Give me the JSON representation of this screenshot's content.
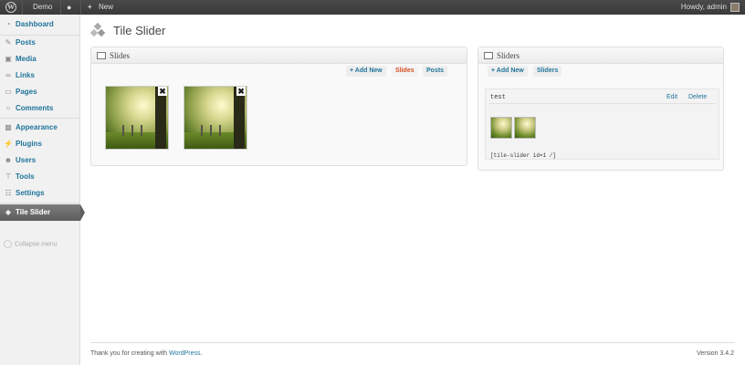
{
  "admin_bar": {
    "site_name": "Demo",
    "new_label": "New",
    "howdy": "Howdy, admin"
  },
  "sidebar": {
    "items": [
      {
        "label": "Dashboard",
        "icon": "dashboard-icon"
      },
      {
        "label": "Posts",
        "icon": "posts-icon"
      },
      {
        "label": "Media",
        "icon": "media-icon"
      },
      {
        "label": "Links",
        "icon": "links-icon"
      },
      {
        "label": "Pages",
        "icon": "pages-icon"
      },
      {
        "label": "Comments",
        "icon": "comments-icon"
      },
      {
        "label": "Appearance",
        "icon": "appearance-icon"
      },
      {
        "label": "Plugins",
        "icon": "plugins-icon"
      },
      {
        "label": "Users",
        "icon": "users-icon"
      },
      {
        "label": "Tools",
        "icon": "tools-icon"
      },
      {
        "label": "Settings",
        "icon": "settings-icon"
      },
      {
        "label": "Tile Slider",
        "icon": "tile-slider-icon"
      }
    ],
    "collapse_label": "Collapse menu"
  },
  "page": {
    "title": "Tile Slider"
  },
  "slides_box": {
    "title": "Slides",
    "add_new": "+ Add New",
    "slides_tab": "Slides",
    "posts_tab": "Posts",
    "slides": [
      {
        "remove": "✖"
      },
      {
        "remove": "✖"
      }
    ]
  },
  "sliders_box": {
    "title": "Sliders",
    "add_new": "+ Add New",
    "sliders_tab": "Sliders",
    "slider": {
      "name": "test",
      "edit": "Edit",
      "delete": "Delete",
      "shortcode": "[tile-slider id=1 /]"
    }
  },
  "footer": {
    "thanks_prefix": "Thank you for creating with ",
    "wordpress": "WordPress",
    "thanks_suffix": ".",
    "version": "Version 3.4.2"
  },
  "colors": {
    "link": "#21759b",
    "active_tab": "#d54e21",
    "admin_bar": "#464646"
  }
}
